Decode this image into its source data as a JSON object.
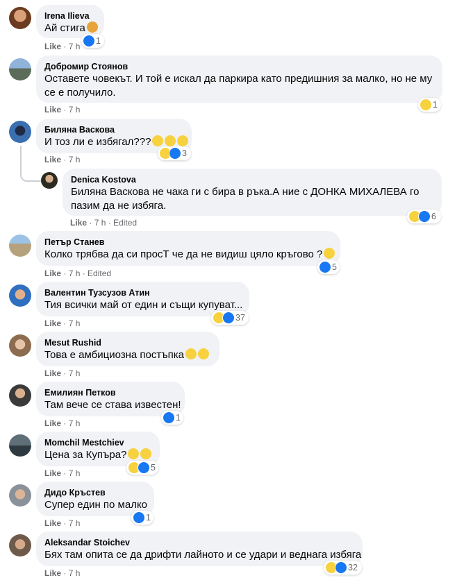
{
  "meta": {
    "like": "Like",
    "sep": " · ",
    "edited": "Edited"
  },
  "comments": [
    {
      "author": "Irena Ilieva",
      "text": "Ай стига",
      "time": "7 h",
      "reactions": "1"
    },
    {
      "author": "Добромир Стоянов",
      "text_line1": "Оставете човекът. И той е искал да паркира като предишния за малко, но не му",
      "text_line2": "се е получило.",
      "time": "7 h",
      "reactions": "1"
    },
    {
      "author": "Биляна Васкова",
      "text": "И тоз ли е избягал???",
      "time": "7 h",
      "reactions": "3"
    },
    {
      "author": "Denica Kostova",
      "text_line1": "Биляна Васкова не чака ги с бира в ръка.А ние с ДОНКА МИХАЛЕВА го",
      "text_line2": "пазим да не избяга.",
      "time": "7 h",
      "edited": true,
      "reactions": "6"
    },
    {
      "author": "Петър Станев",
      "text": "Колко трябва да си просТ че да не видиш цяло кръгово ?",
      "time": "7 h",
      "edited": true,
      "reactions": "5"
    },
    {
      "author": "Валентин Тузсузов Атин",
      "text": "Тия всички май от един и същи купуват...",
      "time": "7 h",
      "reactions": "37"
    },
    {
      "author": "Mesut Rushid",
      "text": "Това е амбициозна постъпка",
      "time": "7 h",
      "reactions": ""
    },
    {
      "author": "Емилиян Петков",
      "text": "Там вече се става известен!",
      "time": "7 h",
      "reactions": "1"
    },
    {
      "author": "Momchil Mestchiev",
      "text": "Цена за Купъра?",
      "time": "7 h",
      "reactions": "5"
    },
    {
      "author": "Дидо Кръстев",
      "text": "Супер един по малко",
      "time": "7 h",
      "reactions": "1"
    },
    {
      "author": "Aleksandar Stoichev",
      "text": "Бях там опита се да дрифти лайното и се удари и веднага избяга",
      "time": "7 h",
      "reactions": "32"
    }
  ],
  "colors": {
    "bubble": "#f0f2f5",
    "like_blue": "#1877f2",
    "haha_yellow": "#f7d23e",
    "meta_gray": "#65676b"
  },
  "icons": {
    "like": "like-reaction-icon",
    "haha": "haha-reaction-icon",
    "grin": "grinning-emoji",
    "woman": "woman-gesturing-emoji",
    "thinking": "thinking-emoji"
  }
}
